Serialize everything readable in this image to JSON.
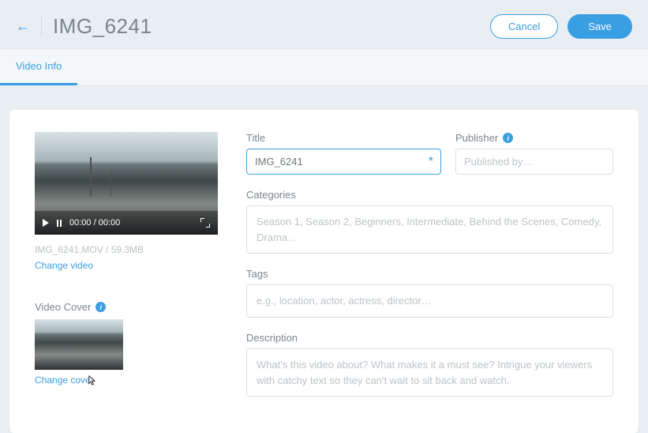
{
  "header": {
    "title": "IMG_6241",
    "cancel_label": "Cancel",
    "save_label": "Save"
  },
  "tabs": {
    "video_info_label": "Video Info"
  },
  "video": {
    "time_current": "00:00",
    "time_total": "00:00",
    "file_info": "IMG_6241.MOV / 59.3MB",
    "change_video_label": "Change video",
    "cover_section_label": "Video Cover",
    "change_cover_label": "Change cover"
  },
  "form": {
    "title_label": "Title",
    "title_value": "IMG_6241",
    "publisher_label": "Publisher",
    "publisher_placeholder": "Published by…",
    "categories_label": "Categories",
    "categories_placeholder": "Season 1, Season 2, Beginners, Intermediate, Behind the Scenes, Comedy, Drama…",
    "tags_label": "Tags",
    "tags_placeholder": "e.g., location, actor, actress, director…",
    "description_label": "Description",
    "description_placeholder": "What's this video about? What makes it a must see? Intrigue your viewers with catchy text so they can't wait to sit back and watch."
  }
}
